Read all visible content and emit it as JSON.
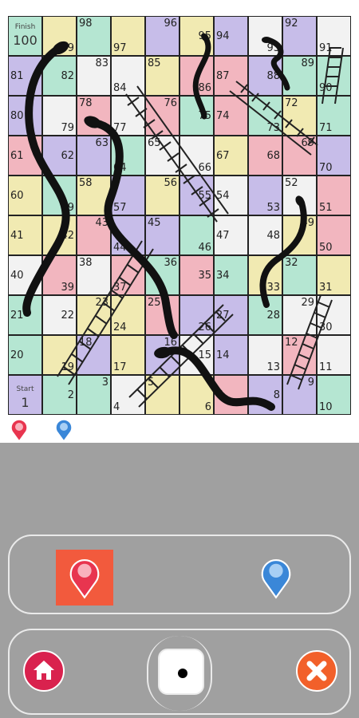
{
  "board": {
    "finish_label": "Finish",
    "start_label": "Start",
    "colors": {
      "pink": "#f2b6bf",
      "green": "#b5e6d2",
      "yellow": "#f1eab2",
      "purple": "#c7bde9",
      "white": "#f2f2f2",
      "grid": "#222222"
    },
    "rows": [
      [
        100,
        99,
        98,
        97,
        96,
        95,
        94,
        93,
        92,
        91
      ],
      [
        81,
        82,
        83,
        84,
        85,
        86,
        87,
        88,
        89,
        90
      ],
      [
        80,
        79,
        78,
        77,
        76,
        75,
        74,
        73,
        72,
        71
      ],
      [
        61,
        62,
        63,
        64,
        65,
        66,
        67,
        68,
        69,
        70
      ],
      [
        60,
        59,
        58,
        57,
        56,
        55,
        54,
        53,
        52,
        51
      ],
      [
        41,
        42,
        43,
        44,
        45,
        46,
        47,
        48,
        49,
        50
      ],
      [
        40,
        39,
        38,
        37,
        36,
        35,
        34,
        33,
        32,
        31
      ],
      [
        21,
        22,
        23,
        24,
        25,
        26,
        27,
        28,
        29,
        30
      ],
      [
        20,
        19,
        18,
        17,
        16,
        15,
        14,
        13,
        12,
        11
      ],
      [
        1,
        2,
        3,
        4,
        5,
        6,
        7,
        8,
        9,
        10
      ]
    ],
    "snake_icon": "snake",
    "ladder_icon": "ladder"
  },
  "tokens": {
    "red": {
      "color": "#e8354f",
      "icon": "map-pin-icon"
    },
    "blue": {
      "color": "#3a87d8",
      "icon": "map-pin-icon"
    }
  },
  "players_panel": {
    "active_player": "red",
    "active_bg": "#f25a3d",
    "players": [
      "red",
      "blue"
    ]
  },
  "controls": {
    "home_icon": "home-icon",
    "home_color": "#d9224e",
    "dice_value": 1,
    "close_icon": "close-icon",
    "close_color": "#f2602a"
  }
}
